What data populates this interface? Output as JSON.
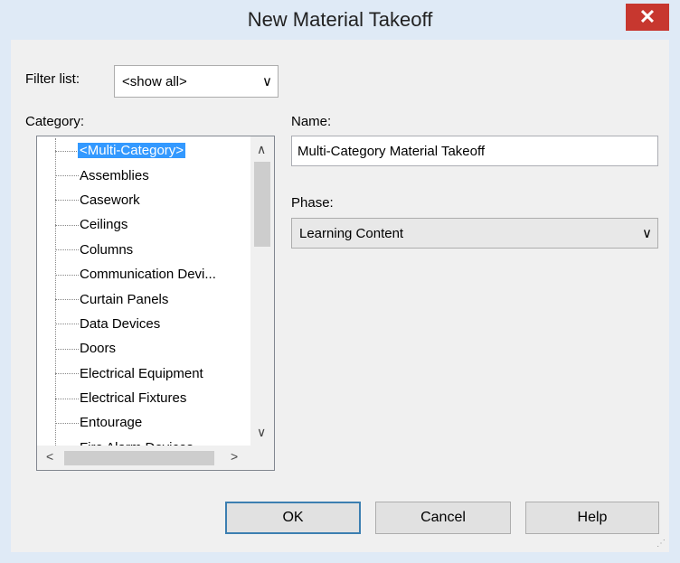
{
  "window": {
    "title": "New Material Takeoff",
    "close_glyph": "✕"
  },
  "filter": {
    "label": "Filter list:",
    "value": "<show all>"
  },
  "category": {
    "label": "Category:",
    "items": [
      "<Multi-Category>",
      "Assemblies",
      "Casework",
      "Ceilings",
      "Columns",
      "Communication Devi...",
      "Curtain Panels",
      "Data Devices",
      "Doors",
      "Electrical Equipment",
      "Electrical Fixtures",
      "Entourage",
      "Fire Alarm Devices"
    ],
    "selected_index": 0
  },
  "name": {
    "label": "Name:",
    "value": "Multi-Category Material Takeoff"
  },
  "phase": {
    "label": "Phase:",
    "value": "Learning Content"
  },
  "buttons": {
    "ok": "OK",
    "cancel": "Cancel",
    "help": "Help"
  },
  "icons": {
    "chevron_down": "∨",
    "scroll_up": "∧",
    "scroll_down": "∨",
    "scroll_left": "<",
    "scroll_right": ">",
    "grip": "⋰"
  }
}
